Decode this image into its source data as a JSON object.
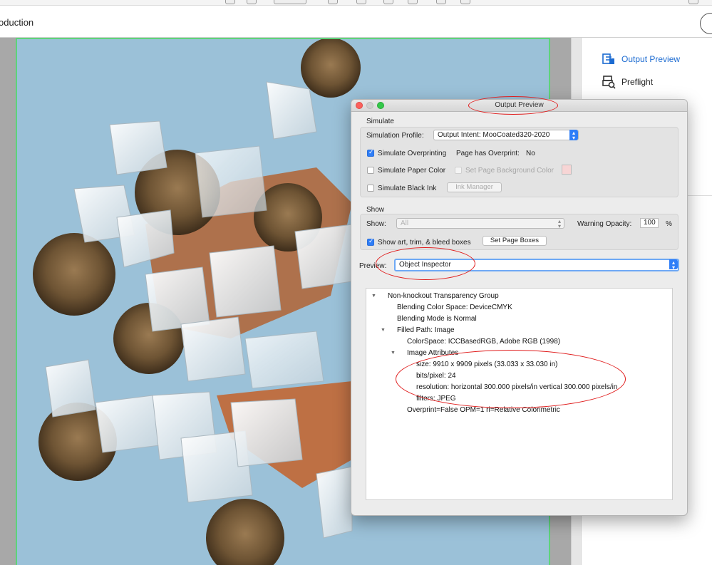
{
  "app": {
    "tool_title": "oduction"
  },
  "right_panel": {
    "items": [
      {
        "label": "Output Preview",
        "icon": "output-preview-icon",
        "active": true
      },
      {
        "label": "Preflight",
        "icon": "preflight-icon",
        "active": false
      }
    ]
  },
  "dialog": {
    "title": "Output Preview",
    "simulate": {
      "section_label": "Simulate",
      "profile_label": "Simulation Profile:",
      "profile_value": "Output Intent: MooCoated320-2020",
      "overprinting_label": "Simulate Overprinting",
      "overprinting_checked": true,
      "has_overprint_label": "Page has Overprint:",
      "has_overprint_value": "No",
      "paper_color_label": "Simulate Paper Color",
      "paper_color_checked": false,
      "page_bg_label": "Set Page Background Color",
      "black_ink_label": "Simulate Black Ink",
      "black_ink_checked": false,
      "ink_manager_label": "Ink Manager"
    },
    "show": {
      "section_label": "Show",
      "show_label": "Show:",
      "show_value": "All",
      "warning_opacity_label": "Warning Opacity:",
      "warning_opacity_value": "100",
      "percent_label": "%",
      "boxes_label": "Show art, trim, & bleed boxes",
      "boxes_checked": true,
      "set_page_boxes_label": "Set Page Boxes"
    },
    "preview": {
      "label": "Preview:",
      "value": "Object Inspector"
    },
    "tree": [
      {
        "text": "Non-knockout Transparency Group",
        "indent": 0,
        "expander": "open"
      },
      {
        "text": "Blending Color Space: DeviceCMYK",
        "indent": 1,
        "expander": ""
      },
      {
        "text": "Blending Mode is Normal",
        "indent": 1,
        "expander": ""
      },
      {
        "text": "Filled Path: Image",
        "indent": 1,
        "expander": "open"
      },
      {
        "text": "ColorSpace: ICCBasedRGB, Adobe RGB (1998)",
        "indent": 2,
        "expander": ""
      },
      {
        "text": "Image Attributes",
        "indent": 2,
        "expander": "open"
      },
      {
        "text": "size: 9910 x 9909 pixels (33.033 x 33.030 in)",
        "indent": 3,
        "expander": ""
      },
      {
        "text": "bits/pixel: 24",
        "indent": 3,
        "expander": ""
      },
      {
        "text": "resolution: horizontal 300.000 pixels/in vertical 300.000 pixels/in",
        "indent": 3,
        "expander": ""
      },
      {
        "text": "filters: JPEG",
        "indent": 3,
        "expander": ""
      },
      {
        "text": "Overprint=False OPM=1 ri=Relative Colorimetric",
        "indent": 2,
        "expander": ""
      }
    ]
  },
  "colors": {
    "accent": "#2f7ef7",
    "annotation": "#e01c1c",
    "page_background": "#9bc1d8",
    "page_border": "#5ed37a"
  }
}
